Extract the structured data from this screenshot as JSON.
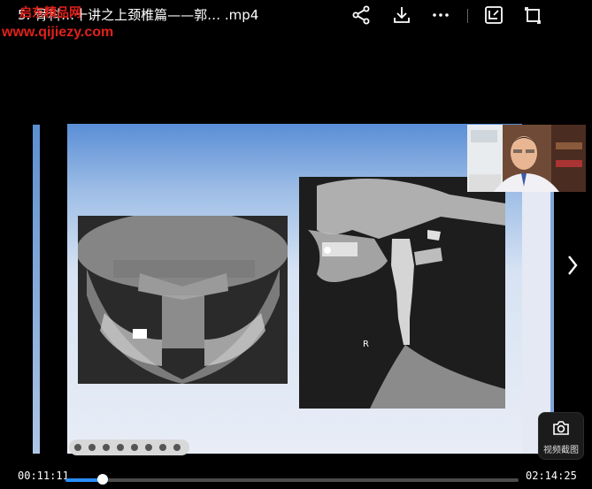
{
  "window": {
    "title": "5. 骨科…十讲之上颈椎篇——郭… .mp4"
  },
  "watermark": {
    "line1": "启东精品网",
    "line2": "www.qijiezy.com"
  },
  "toolbar_icons": [
    "share-icon",
    "download-icon",
    "more-icon",
    "screenshot-crop-icon",
    "fullscreen-icon"
  ],
  "player": {
    "current_time": "00:11:11",
    "total_time": "02:14:25",
    "progress_fraction": 0.083,
    "accent": "#2a8cff"
  },
  "overlay": {
    "screenshot_label": "视频截图",
    "xray_marker": "R"
  }
}
